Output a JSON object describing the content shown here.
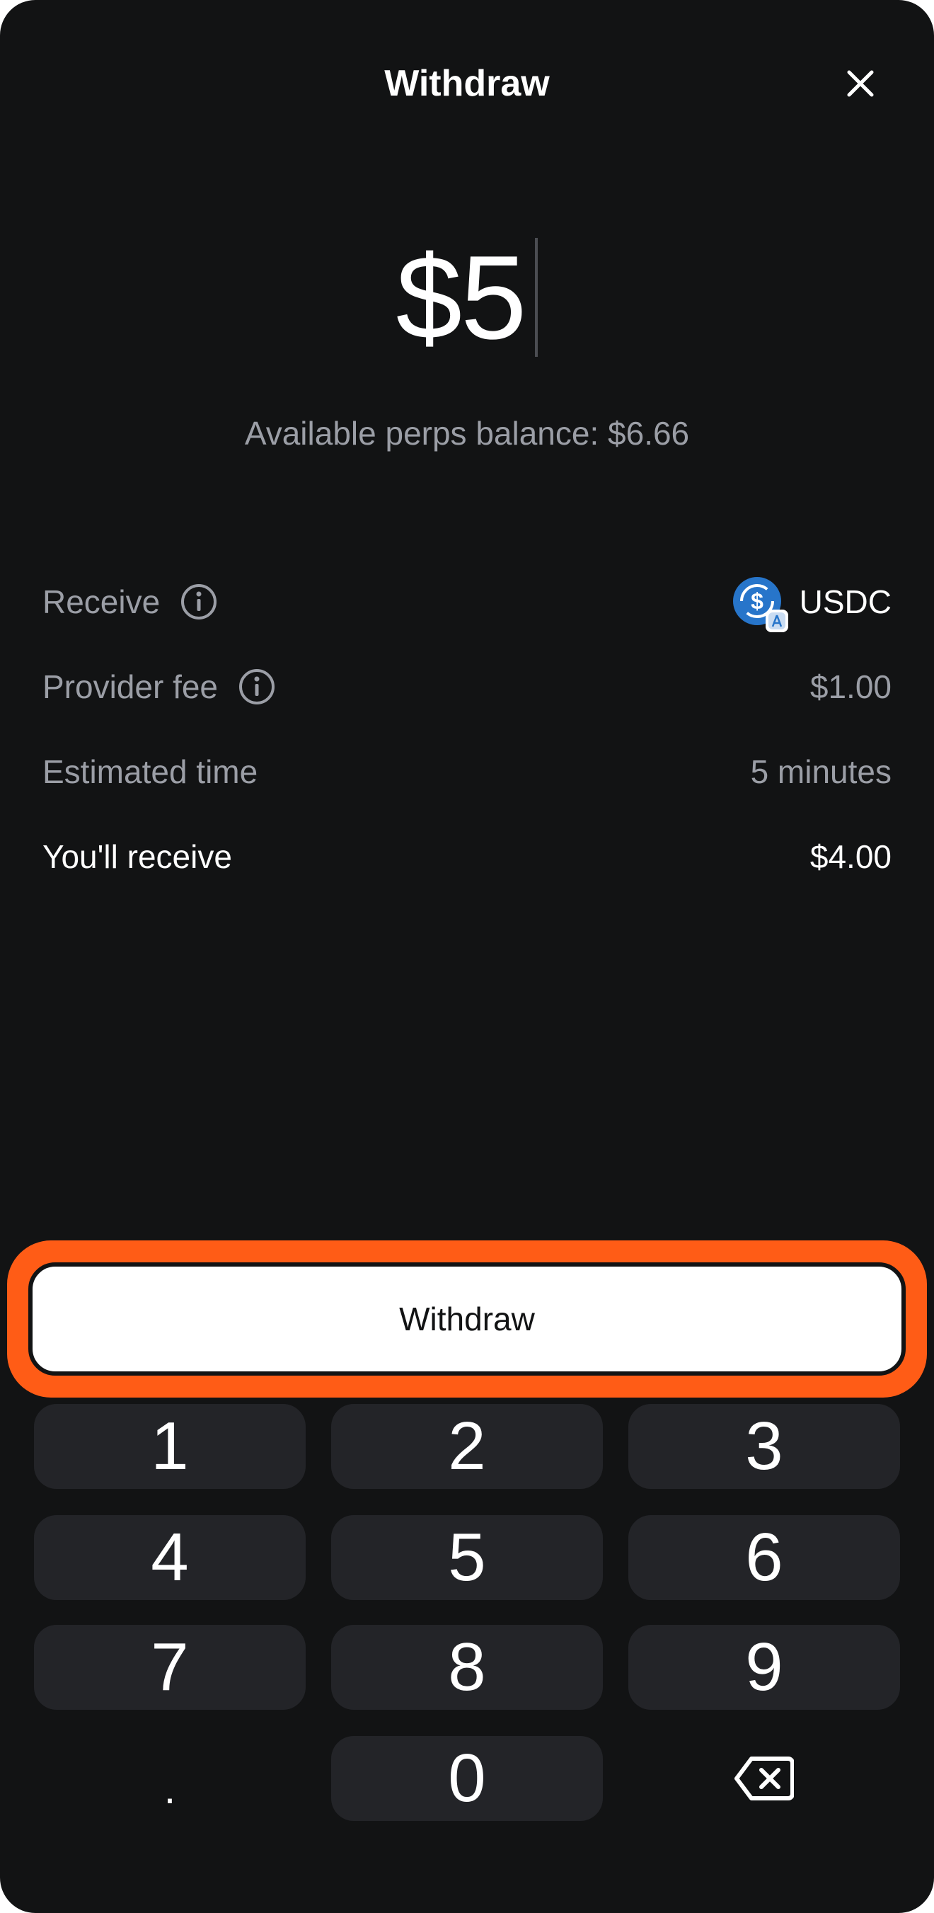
{
  "header": {
    "title": "Withdraw",
    "close_icon": "close-icon"
  },
  "amount": {
    "value": "$5"
  },
  "balance": {
    "text": "Available perps balance: $6.66"
  },
  "details": {
    "receive": {
      "label": "Receive",
      "token": "USDC",
      "info_icon": "info-icon",
      "token_icon": "usdc-icon"
    },
    "provider_fee": {
      "label": "Provider fee",
      "value": "$1.00",
      "info_icon": "info-icon"
    },
    "estimated_time": {
      "label": "Estimated time",
      "value": "5 minutes"
    },
    "you_receive": {
      "label": "You'll receive",
      "value": "$4.00"
    }
  },
  "action": {
    "label": "Withdraw",
    "highlight_color": "#ff5c16"
  },
  "keypad": {
    "keys": [
      "1",
      "2",
      "3",
      "4",
      "5",
      "6",
      "7",
      "8",
      "9",
      ".",
      "0"
    ],
    "backspace_icon": "backspace-icon"
  },
  "colors": {
    "background": "#121314",
    "muted_text": "#9b9ea6",
    "key_background": "#232428",
    "accent_ring": "#ff5c16",
    "usdc_blue": "#2775ca"
  }
}
